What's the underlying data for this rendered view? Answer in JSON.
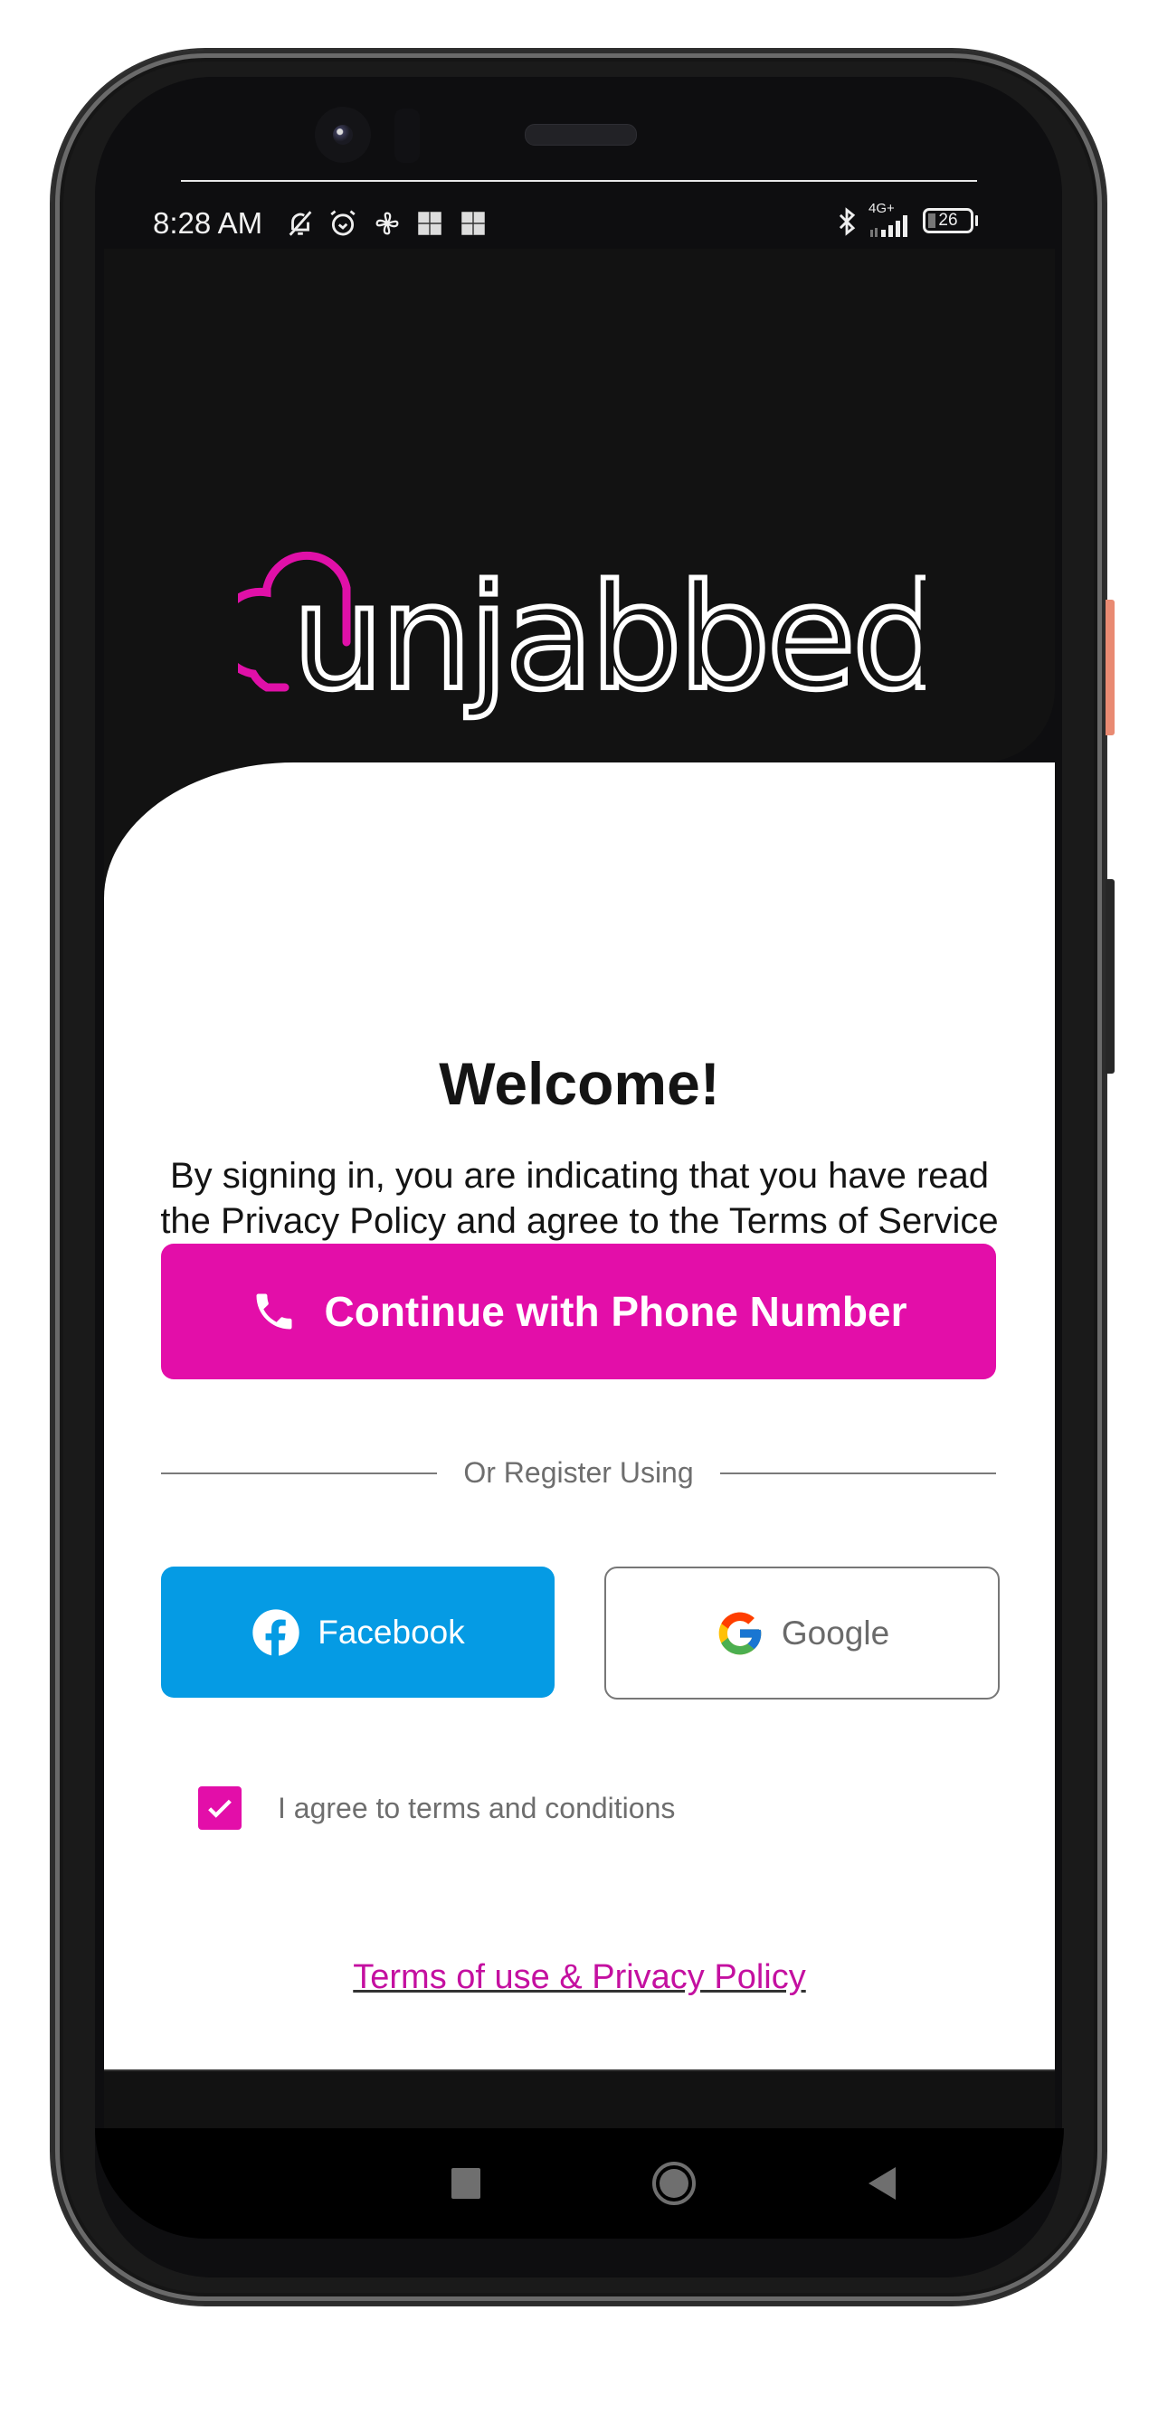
{
  "status_bar": {
    "time": "8:28 AM",
    "left_icons": [
      "notifications-off-icon",
      "alarm-icon",
      "fan-icon",
      "app-notification-icon",
      "app-notification-icon"
    ],
    "network_label": "4G+",
    "battery_level": "26",
    "right_icons": [
      "bluetooth-icon",
      "signal-icon",
      "battery-icon"
    ]
  },
  "header": {
    "logo_text": "Unjabbed",
    "logo_accent_color": "#e010a8"
  },
  "main": {
    "title": "Welcome!",
    "intro": "By signing in, you are indicating that you have read the Privacy Policy and agree to the Terms of Service",
    "phone_button_label": "Continue with Phone Number",
    "divider_label": "Or Register Using",
    "facebook_button_label": "Facebook",
    "google_button_label": "Google",
    "agree_checked": true,
    "agree_label": "I agree to terms and conditions",
    "terms_link_label": "Terms of use & Privacy Policy"
  },
  "colors": {
    "primary": "#e30ea9",
    "facebook": "#059be4",
    "header_bg": "#121212",
    "link": "#c410a0"
  },
  "nav_bar": {
    "buttons": [
      "recents",
      "home",
      "back"
    ]
  }
}
